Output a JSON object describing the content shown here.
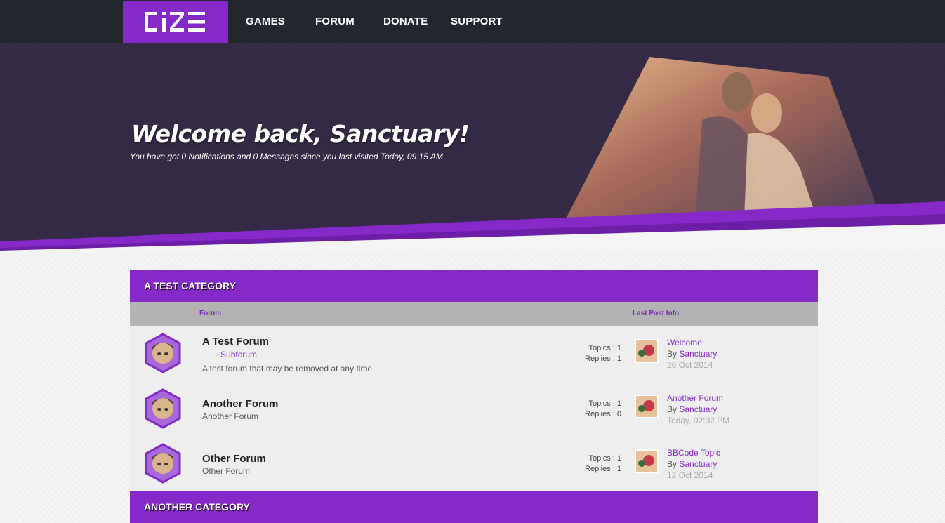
{
  "nav": {
    "logo_alt": "CIZE",
    "items": [
      "GAMES",
      "FORUM",
      "DONATE",
      "SUPPORT"
    ]
  },
  "hero": {
    "title": "Welcome back, Sanctuary!",
    "subtitle": "You have got 0 Notifications and 0 Messages since you last visited Today, 09:15 AM"
  },
  "columns": {
    "forum": "Forum",
    "last_post": "Last Post Info"
  },
  "categories": [
    {
      "name": "A TEST CATEGORY",
      "forums": [
        {
          "name": "A Test Forum",
          "subforum": "Subforum",
          "description": "A test forum that may be removed at any time",
          "topics": "Topics : 1",
          "replies": "Replies : 1",
          "last_post_title": "Welcome!",
          "last_post_by": "By",
          "last_post_user": "Sanctuary",
          "last_post_date": "26 Oct 2014"
        },
        {
          "name": "Another Forum",
          "description": "Another Forum",
          "topics": "Topics : 1",
          "replies": "Replies : 0",
          "last_post_title": "Another Forum",
          "last_post_by": "By",
          "last_post_user": "Sanctuary",
          "last_post_date": "Today, 02:02 PM"
        },
        {
          "name": "Other Forum",
          "description": "Other Forum",
          "topics": "Topics : 1",
          "replies": "Replies : 1",
          "last_post_title": "BBCode Topic",
          "last_post_by": "By",
          "last_post_user": "Sanctuary",
          "last_post_date": "12 Oct 2014"
        }
      ]
    },
    {
      "name": "ANOTHER CATEGORY"
    }
  ],
  "colors": {
    "accent": "#8529c8",
    "nav_bg": "#22262f",
    "hero_bg": "#342a46"
  }
}
